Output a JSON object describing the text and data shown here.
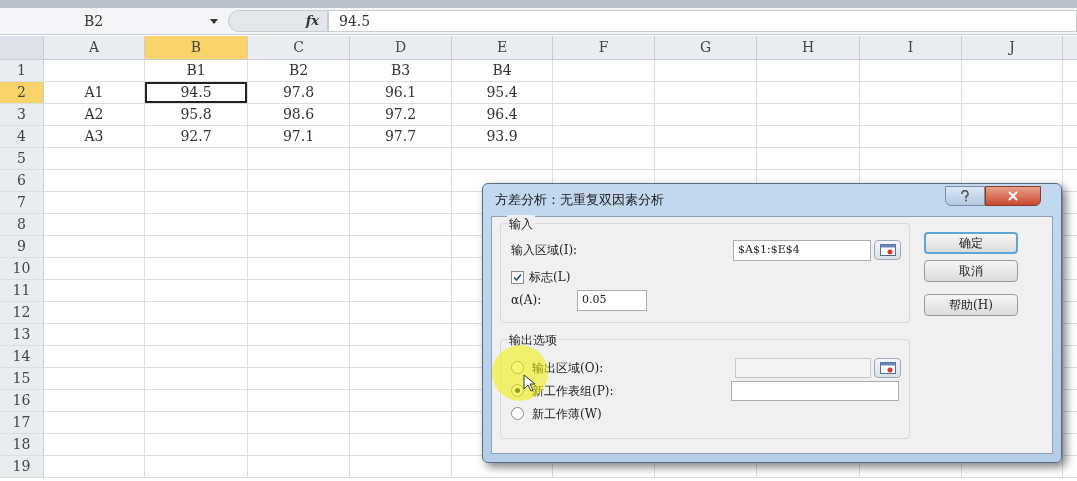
{
  "formula_bar": {
    "name_box": "B2",
    "fx": "fx",
    "value": "94.5"
  },
  "columns": [
    {
      "label": "A",
      "selected": false
    },
    {
      "label": "B",
      "selected": true
    },
    {
      "label": "C",
      "selected": false
    },
    {
      "label": "D",
      "selected": false
    },
    {
      "label": "E",
      "selected": false
    },
    {
      "label": "F",
      "selected": false
    },
    {
      "label": "G",
      "selected": false
    },
    {
      "label": "H",
      "selected": false
    },
    {
      "label": "I",
      "selected": false
    },
    {
      "label": "J",
      "selected": false
    }
  ],
  "rows": [
    {
      "header": "1",
      "selected": false,
      "cells": {
        "B": "B1",
        "C": "B2",
        "D": "B3",
        "E": "B4"
      }
    },
    {
      "header": "2",
      "selected": true,
      "cells": {
        "A": "A1",
        "B": "94.5",
        "C": "97.8",
        "D": "96.1",
        "E": "95.4"
      }
    },
    {
      "header": "3",
      "selected": false,
      "cells": {
        "A": "A2",
        "B": "95.8",
        "C": "98.6",
        "D": "97.2",
        "E": "96.4"
      }
    },
    {
      "header": "4",
      "selected": false,
      "cells": {
        "A": "A3",
        "B": "92.7",
        "C": "97.1",
        "D": "97.7",
        "E": "93.9"
      }
    },
    {
      "header": "5",
      "selected": false
    },
    {
      "header": "6",
      "selected": false
    },
    {
      "header": "7",
      "selected": false
    },
    {
      "header": "8",
      "selected": false
    },
    {
      "header": "9",
      "selected": false
    },
    {
      "header": "10",
      "selected": false
    },
    {
      "header": "11",
      "selected": false
    },
    {
      "header": "12",
      "selected": false
    },
    {
      "header": "13",
      "selected": false
    },
    {
      "header": "14",
      "selected": false
    },
    {
      "header": "15",
      "selected": false
    },
    {
      "header": "16",
      "selected": false
    },
    {
      "header": "17",
      "selected": false
    },
    {
      "header": "18",
      "selected": false
    },
    {
      "header": "19",
      "selected": false
    }
  ],
  "dialog": {
    "title": "方差分析：无重复双因素分析",
    "input": {
      "title": "输入",
      "range_label": "输入区域(I):",
      "range_value": "$A$1:$E$4",
      "labels_checkbox": {
        "label": "标志(L)",
        "checked": true
      },
      "alpha_label": "α(A):",
      "alpha_value": "0.05"
    },
    "output": {
      "title": "输出选项",
      "options": [
        {
          "label": "输出区域(O):",
          "selected": false,
          "kind": "range"
        },
        {
          "label": "新工作表组(P):",
          "selected": true,
          "kind": "name"
        },
        {
          "label": "新工作薄(W)",
          "selected": false,
          "kind": "plain"
        }
      ]
    },
    "buttons": [
      {
        "label": "确定",
        "default": true
      },
      {
        "label": "取消",
        "default": false
      },
      {
        "label": "帮助(H)",
        "default": false
      }
    ]
  }
}
